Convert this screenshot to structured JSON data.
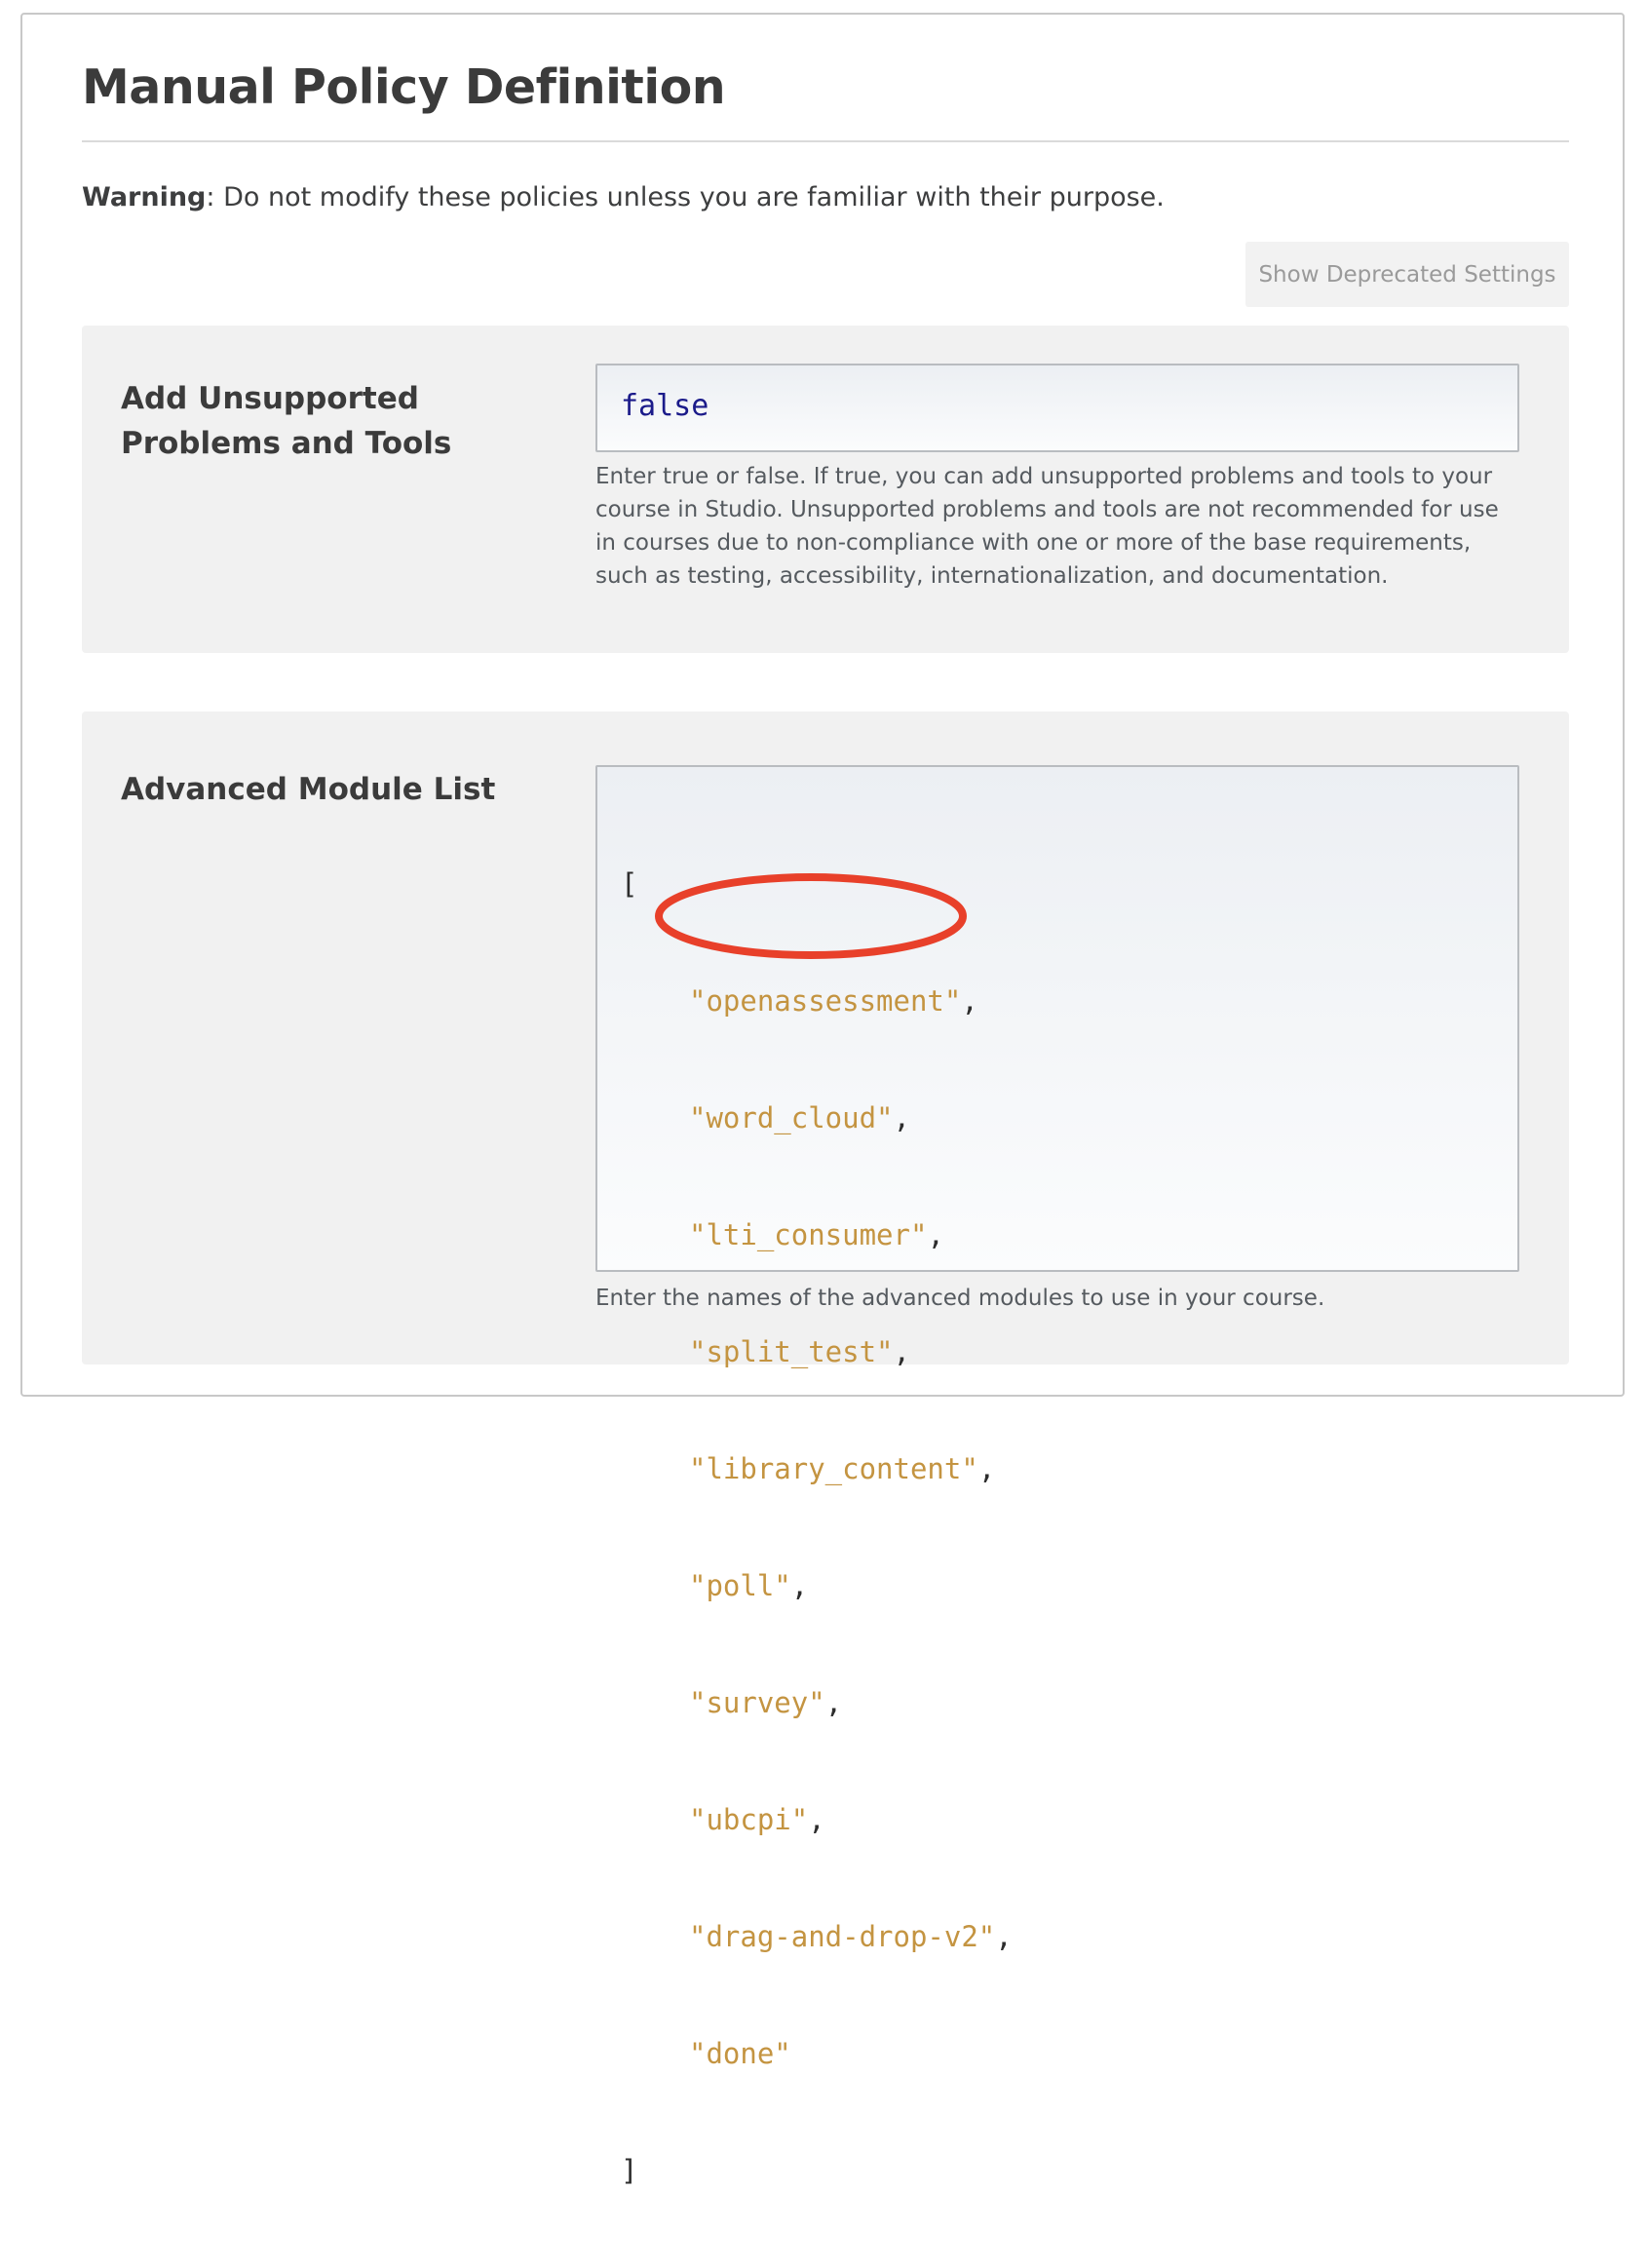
{
  "page": {
    "title": "Manual Policy Definition",
    "warning_label": "Warning",
    "warning_text": ": Do not modify these policies unless you are familiar with their purpose.",
    "deprecated_button_label": "Show Deprecated Settings"
  },
  "settings": [
    {
      "label": "Add Unsupported Problems and Tools",
      "value": "false",
      "help": "Enter true or false. If true, you can add unsupported problems and tools to your course in Studio. Unsupported problems and tools are not recommended for use in courses due to non-compliance with one or more of the base requirements, such as testing, accessibility, internationalization, and documentation."
    },
    {
      "label": "Advanced Module List",
      "open_bracket": "[",
      "close_bracket": "]",
      "modules": [
        "\"openassessment\"",
        "\"word_cloud\"",
        "\"lti_consumer\"",
        "\"split_test\"",
        "\"library_content\"",
        "\"poll\"",
        "\"survey\"",
        "\"ubcpi\"",
        "\"drag-and-drop-v2\"",
        "\"done\""
      ],
      "separators": [
        ",",
        ",",
        ",",
        ",",
        ",",
        ",",
        ",",
        ",",
        ",",
        ""
      ],
      "help": "Enter the names of the advanced modules to use in your course."
    }
  ],
  "annotation": {
    "shape": "ellipse",
    "color": "#e8402a",
    "highlighted_item": "lti_consumer"
  }
}
